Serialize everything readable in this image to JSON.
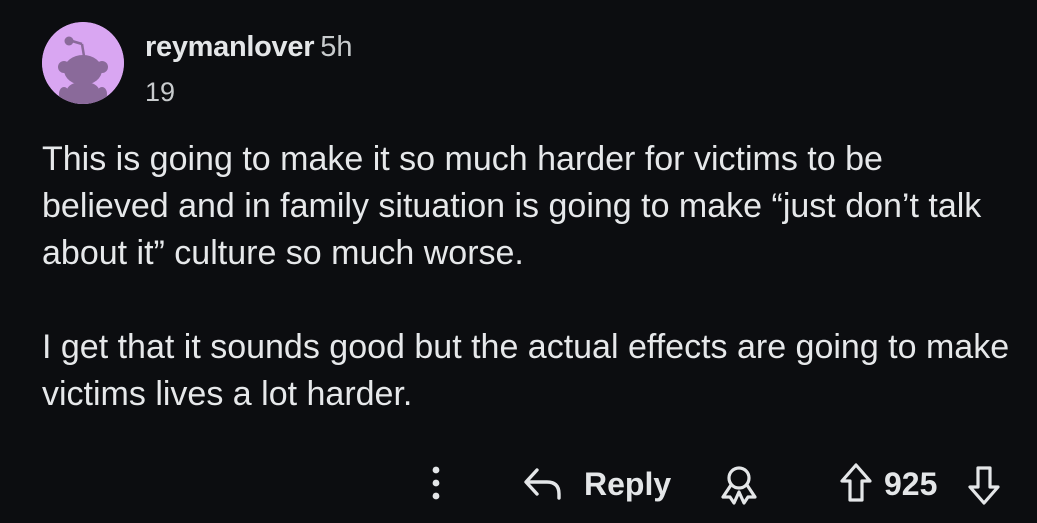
{
  "comment": {
    "author": "reymanlover",
    "time_ago": "5h",
    "score_line": "19",
    "paragraphs": [
      "This is going to make it so much harder for victims to be believed and in family situation is going to make “just don’t talk about it” culture so much worse.",
      "I get that it sounds good but the actual effects are going to make victims lives a lot harder."
    ]
  },
  "actions": {
    "more_icon": "more-vertical-icon",
    "reply_icon": "reply-arrow-icon",
    "reply_label": "Reply",
    "award_icon": "award-icon",
    "upvote_icon": "upvote-arrow-icon",
    "vote_count": "925",
    "downvote_icon": "downvote-arrow-icon"
  },
  "colors": {
    "background": "#0c0d10",
    "text": "#e6e8ea",
    "avatar_bg": "#d9a6f2",
    "avatar_figure": "#8a6a9a"
  }
}
